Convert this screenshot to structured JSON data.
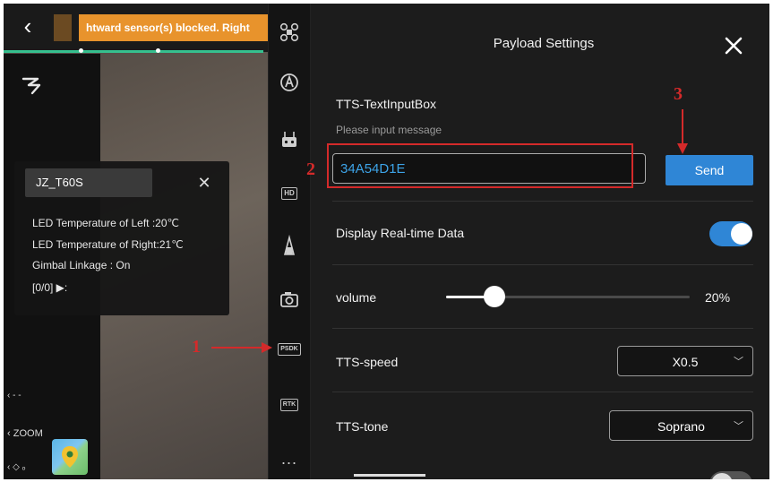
{
  "camera": {
    "warning_text": "htward sensor(s) blocked. Right",
    "info_panel": {
      "title": "JZ_T60S",
      "lines": [
        "LED Temperature of  Left :20℃",
        "LED Temperature of Right:21℃",
        "Gimbal Linkage : On",
        "[0/0] ▶:"
      ]
    },
    "zoom_label": "ZOOM"
  },
  "toolbar": {
    "icons": [
      "drone-icon",
      "autopilot-icon",
      "controller-icon",
      "hd-icon",
      "figure-icon",
      "camera-icon",
      "psdk-icon",
      "rtk-icon",
      "more-icon"
    ],
    "hd_label": "HD",
    "psdk_label": "PSDK",
    "rtk_label": "RTK",
    "more_label": "..."
  },
  "settings": {
    "title": "Payload Settings",
    "tts_label": "TTS-TextInputBox",
    "tts_placeholder": "Please input message",
    "tts_value": "34A54D1E",
    "send_label": "Send",
    "realtime_label": "Display Real-time Data",
    "realtime_on": true,
    "volume_label": "volume",
    "volume_value": "20%",
    "volume_fraction": 0.2,
    "speed_label": "TTS-speed",
    "speed_value": "X0.5",
    "tone_label": "TTS-tone",
    "tone_value": "Soprano"
  },
  "annotations": {
    "one": "1",
    "two": "2",
    "three": "3"
  },
  "colors": {
    "accent": "#2f86d6",
    "warning": "#e8932c",
    "annotation": "#d42a2a",
    "input_text": "#3da4e8"
  }
}
